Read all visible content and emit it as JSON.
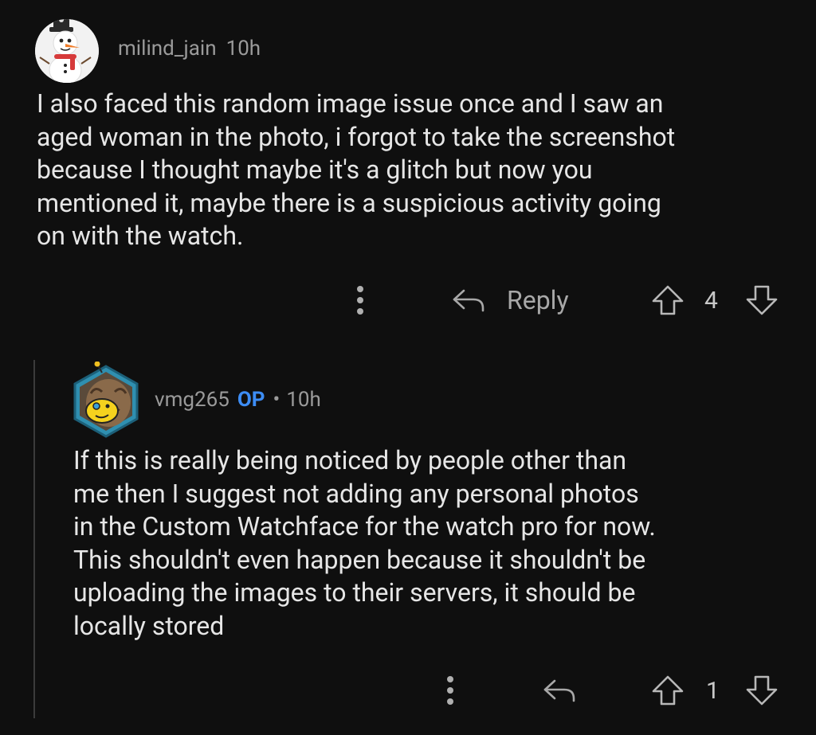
{
  "comments": [
    {
      "username": "milind_jain",
      "time": "10h",
      "body": "I also faced this random image issue once and I saw an\naged woman in the photo, i forgot to take the screenshot\nbecause I thought maybe it's a glitch but now you\nmentioned it, maybe  there is a suspicious activity going\non with the watch.",
      "reply_label": "Reply",
      "score": "4"
    },
    {
      "username": "vmg265",
      "badge": "OP",
      "separator": "•",
      "time": "10h",
      "body": "If this is really being noticed by people other than\nme then I suggest not adding any personal photos\nin the Custom Watchface for the watch pro for now.\nThis shouldn't even happen because it shouldn't be\nuploading the images to their servers, it should be\nlocally stored",
      "score": "1"
    }
  ],
  "icons": {
    "more": "more-vertical-icon",
    "reply": "reply-arrow-icon",
    "upvote": "upvote-arrow-icon",
    "downvote": "downvote-arrow-icon"
  },
  "colors": {
    "background": "#0f0f0f",
    "text": "#e6e6e6",
    "meta": "#9a9a9a",
    "op_badge": "#3d8df5",
    "thread_line": "#3b3b3b"
  }
}
